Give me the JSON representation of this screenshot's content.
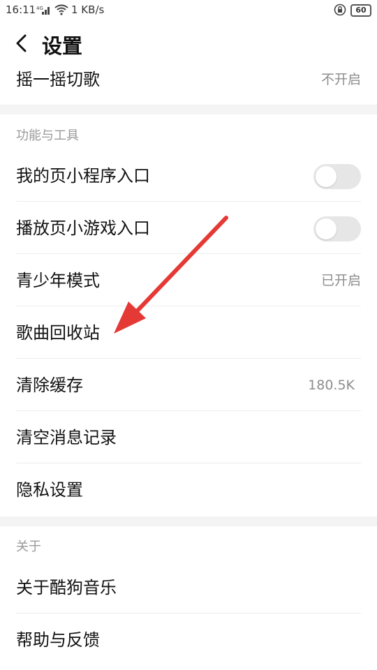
{
  "status_bar": {
    "time": "16:11",
    "net_speed": "1 KB/s",
    "battery": "60"
  },
  "header": {
    "title": "设置"
  },
  "rows_top": [
    {
      "label": "摇一摇切歌",
      "value": "不开启"
    }
  ],
  "section_tools": {
    "title": "功能与工具",
    "items": [
      {
        "label": "我的页小程序入口",
        "toggle": false
      },
      {
        "label": "播放页小游戏入口",
        "toggle": false
      },
      {
        "label": "青少年模式",
        "value": "已开启"
      },
      {
        "label": "歌曲回收站"
      },
      {
        "label": "清除缓存",
        "value": "180.5K"
      },
      {
        "label": "清空消息记录"
      },
      {
        "label": "隐私设置"
      }
    ]
  },
  "section_about": {
    "title": "关于",
    "items": [
      {
        "label": "关于酷狗音乐"
      },
      {
        "label": "帮助与反馈"
      }
    ]
  },
  "colors": {
    "annotation_arrow": "#e53935",
    "toggle_off": "#e6e6e6",
    "section_gap": "#f4f4f4"
  }
}
